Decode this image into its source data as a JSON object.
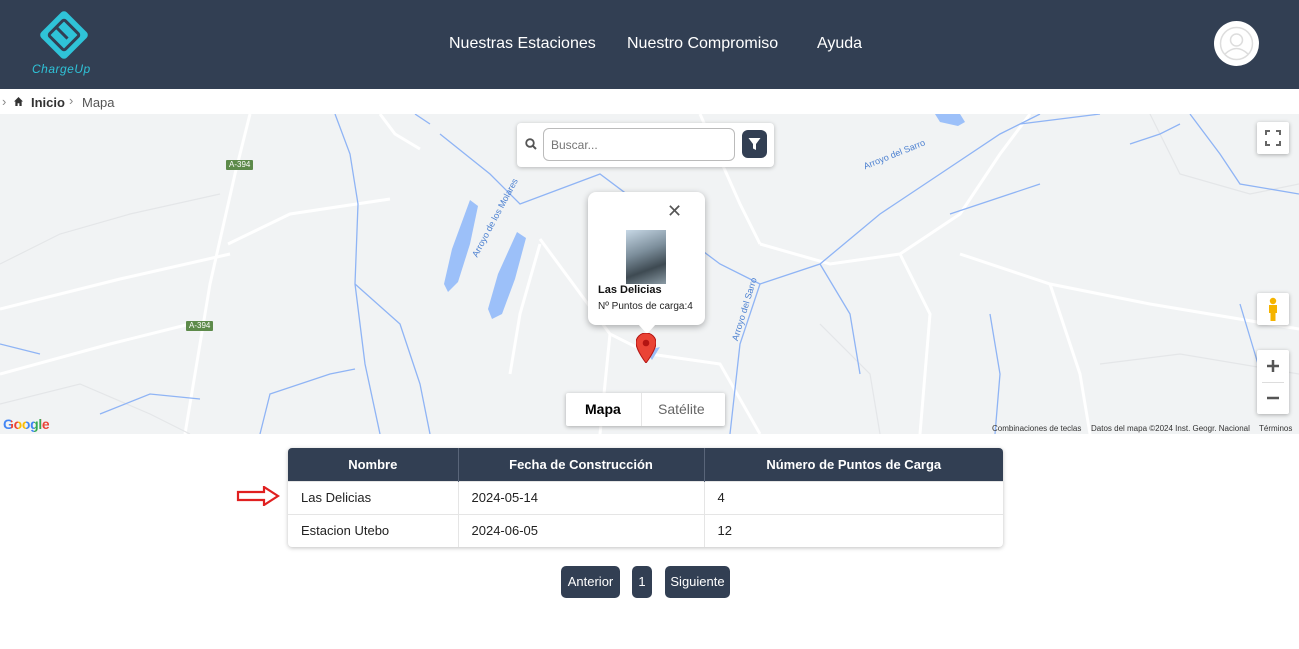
{
  "header": {
    "logo_text": "ChargeUp",
    "nav": [
      "Nuestras Estaciones",
      "Nuestro Compromiso",
      "Ayuda"
    ],
    "accent_color": "#2fc3d8",
    "bg_color": "#323f53"
  },
  "breadcrumb": {
    "home": "Inicio",
    "current": "Mapa"
  },
  "map": {
    "search_placeholder": "Buscar...",
    "popup": {
      "title": "Las Delicias",
      "subtitle": "Nº Puntos de carga:4"
    },
    "map_types": [
      "Mapa",
      "Satélite"
    ],
    "selected_map_type": "Mapa",
    "road_labels": [
      "A-394",
      "A-394"
    ],
    "water_labels": [
      "Arroyo de los Molares",
      "Arroyo del Sarro",
      "Arroyo del Sarro"
    ],
    "google_label": "Google",
    "attribution": {
      "shortcuts": "Combinaciones de teclas",
      "data": "Datos del mapa ©2024 Inst. Geogr. Nacional",
      "terms": "Términos"
    },
    "icons": [
      "search-icon",
      "filter-icon",
      "fullscreen-icon",
      "pegman-icon",
      "zoom-in-icon",
      "zoom-out-icon",
      "map-pin-icon",
      "close-icon"
    ]
  },
  "table": {
    "headers": [
      "Nombre",
      "Fecha de Construcción",
      "Número de Puntos de Carga"
    ],
    "rows": [
      [
        "Las Delicias",
        "2024-05-14",
        "4"
      ],
      [
        "Estacion Utebo",
        "2024-06-05",
        "12"
      ]
    ]
  },
  "pagination": {
    "prev": "Anterior",
    "page": "1",
    "next": "Siguiente"
  }
}
